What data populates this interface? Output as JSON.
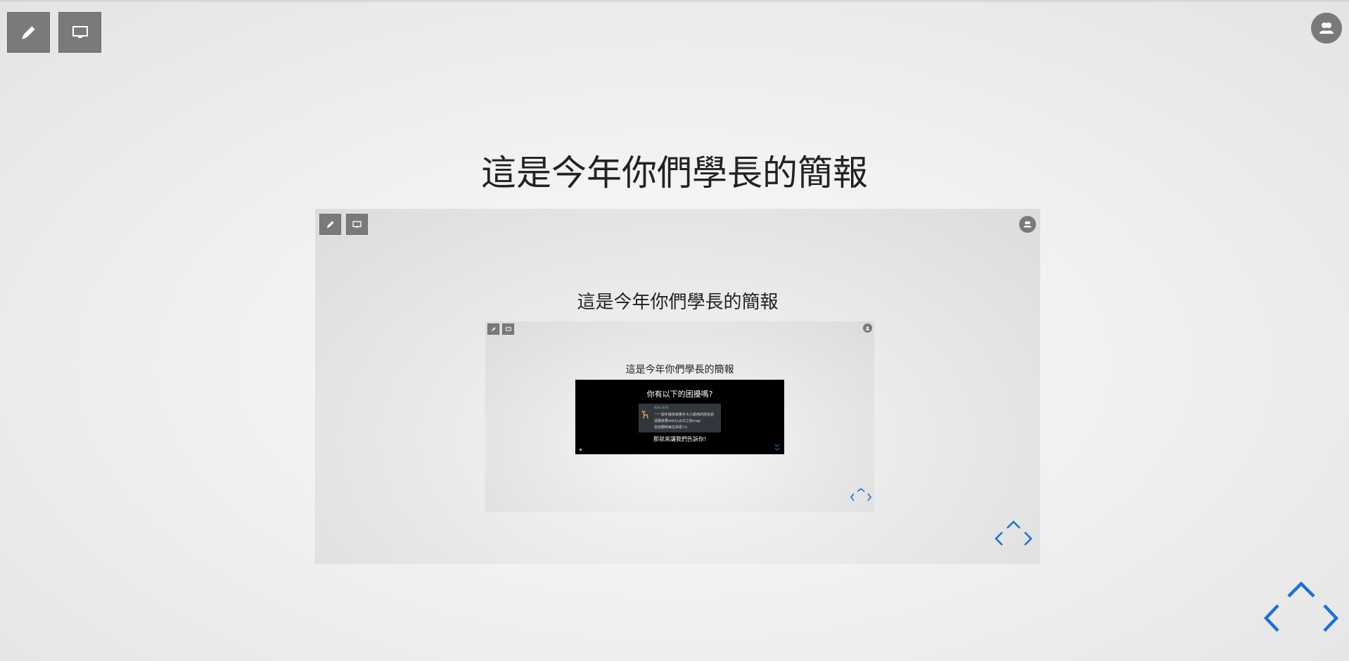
{
  "toolbar": {
    "draw_button": "draw",
    "screen_button": "screen"
  },
  "slide": {
    "title": "這是今年你們學長的簡報"
  },
  "nested_slide_1": {
    "title": "這是今年你們學長的簡報"
  },
  "nested_slide_2": {
    "title": "這是今年你們學長的簡報"
  },
  "embedded_dark_slide": {
    "title": "你有以下的困擾嗎?",
    "card_lines": [
      "$$$,$$$",
      "一一開手機後總覺手大小錯用的朋友結",
      "遠機後要wiki以太次之後map",
      "但但關時每在來看?.k"
    ],
    "footer": "那就來讓我們告訴你!"
  },
  "icons": {
    "draw": "pencil-icon",
    "screen": "monitor-icon",
    "users": "users-icon",
    "nav": "navigation-arrows-icon"
  },
  "colors": {
    "accent": "#1e6fd9",
    "button": "#7a7a7a",
    "text": "#222222"
  }
}
